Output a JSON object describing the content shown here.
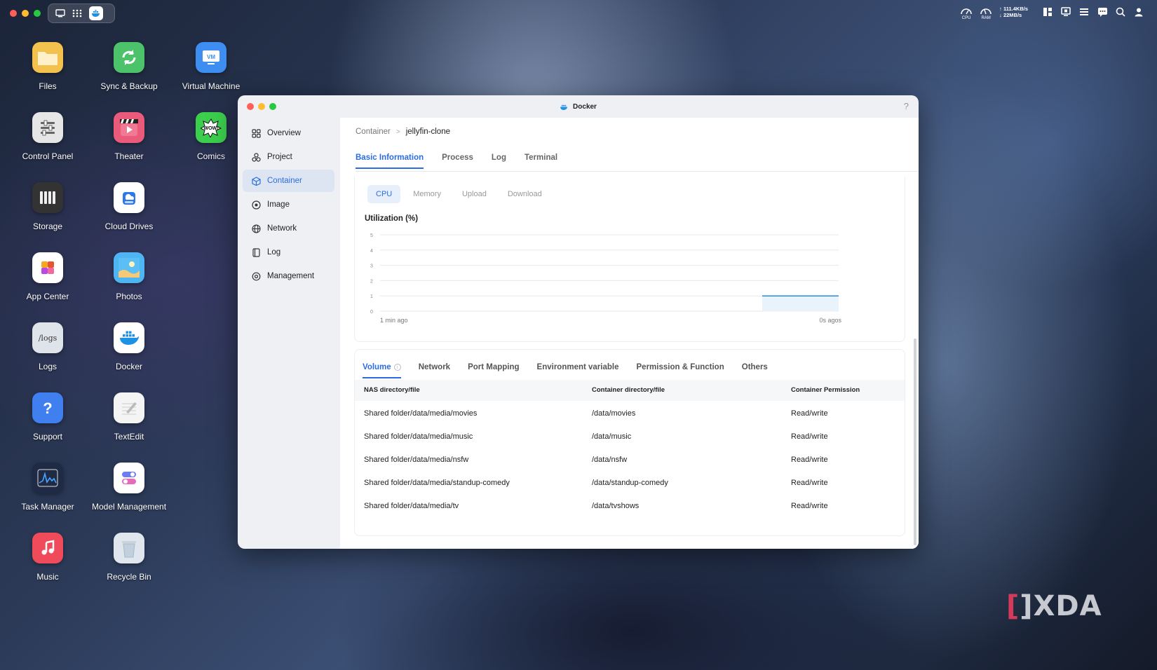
{
  "menubar": {
    "traffic_colors": [
      "#ff5f57",
      "#febc2e",
      "#28c840"
    ],
    "tray": {
      "cpu_label": "CPU",
      "ram_label": "RAM",
      "upload_speed": "↑ 111.4KB/s",
      "download_speed": "↓ 22MB/s"
    }
  },
  "desktop": {
    "icons": [
      {
        "label": "Files",
        "icon": "folder-icon",
        "color": "#f2c14e"
      },
      {
        "label": "Sync & Backup",
        "icon": "sync-icon",
        "color": "#4cc36a"
      },
      {
        "label": "Virtual Machine",
        "icon": "vm-icon",
        "color": "#3d8ef0"
      },
      {
        "label": "Control Panel",
        "icon": "sliders-icon",
        "color": "#e6e6e6"
      },
      {
        "label": "Theater",
        "icon": "clapper-icon",
        "color": "#ea5a7a"
      },
      {
        "label": "Comics",
        "icon": "wow-icon",
        "color": "#3ccf4e"
      },
      {
        "label": "Storage",
        "icon": "drives-icon",
        "color": "#333333"
      },
      {
        "label": "Cloud Drives",
        "icon": "cloud-drive-icon",
        "color": "#ffffff"
      },
      {
        "label": "App Center",
        "icon": "app-grid-icon",
        "color": "#ffffff"
      },
      {
        "label": "Photos",
        "icon": "photos-icon",
        "color": "#4fb5f2"
      },
      {
        "label": "Logs",
        "icon": "logs-icon",
        "color": "#dfe3ea",
        "text": "/logs"
      },
      {
        "label": "Docker",
        "icon": "docker-icon",
        "color": "#ffffff"
      },
      {
        "label": "Support",
        "icon": "help-icon",
        "color": "#3f7ff0"
      },
      {
        "label": "TextEdit",
        "icon": "textedit-icon",
        "color": "#f4f4f4"
      },
      {
        "label": "Task Manager",
        "icon": "activity-icon",
        "color": "#1f2a44"
      },
      {
        "label": "Model Management",
        "icon": "toggles-icon",
        "color": "#ffffff"
      },
      {
        "label": "Music",
        "icon": "music-note-icon",
        "color": "#ef4b5a"
      },
      {
        "label": "Recycle Bin",
        "icon": "trash-icon",
        "color": "#dfe6ee"
      }
    ]
  },
  "window": {
    "title": "Docker",
    "help": "?",
    "accent": "#2b6de0",
    "sidebar": [
      {
        "label": "Overview",
        "icon": "grid-icon",
        "active": false
      },
      {
        "label": "Project",
        "icon": "project-icon",
        "active": false
      },
      {
        "label": "Container",
        "icon": "cube-icon",
        "active": true
      },
      {
        "label": "Image",
        "icon": "disc-icon",
        "active": false
      },
      {
        "label": "Network",
        "icon": "globe-icon",
        "active": false
      },
      {
        "label": "Log",
        "icon": "log-icon",
        "active": false
      },
      {
        "label": "Management",
        "icon": "gear-icon",
        "active": false
      }
    ],
    "breadcrumb": {
      "parent": "Container",
      "separator": ">",
      "current": "jellyfin-clone"
    },
    "tabs": [
      "Basic Information",
      "Process",
      "Log",
      "Terminal"
    ],
    "active_tab": "Basic Information",
    "metric_tabs": [
      "CPU",
      "Memory",
      "Upload",
      "Download"
    ],
    "active_metric": "CPU",
    "chart_title": "Utilization (%)",
    "volume_tabs": [
      "Volume",
      "Network",
      "Port Mapping",
      "Environment variable",
      "Permission & Function",
      "Others"
    ],
    "active_volume_tab": "Volume",
    "table": {
      "headers": [
        "NAS directory/file",
        "Container directory/file",
        "Container Permission"
      ],
      "rows": [
        [
          "Shared folder/data/media/movies",
          "/data/movies",
          "Read/write"
        ],
        [
          "Shared folder/data/media/music",
          "/data/music",
          "Read/write"
        ],
        [
          "Shared folder/data/media/nsfw",
          "/data/nsfw",
          "Read/write"
        ],
        [
          "Shared folder/data/media/standup-comedy",
          "/data/standup-comedy",
          "Read/write"
        ],
        [
          "Shared folder/data/media/tv",
          "/data/tvshows",
          "Read/write"
        ]
      ]
    }
  },
  "chart_data": {
    "type": "area",
    "title": "Utilization (%)",
    "xlabel": "",
    "ylabel": "",
    "x_tick_labels": [
      "1 min ago",
      "0s agos"
    ],
    "y_ticks": [
      0,
      1,
      2,
      3,
      4,
      5
    ],
    "ylim": [
      0,
      5
    ],
    "xlim": [
      0,
      60
    ],
    "series": [
      {
        "values": [
          {
            "x": 50,
            "y": 1
          },
          {
            "x": 60,
            "y": 1
          }
        ],
        "color": "#2b8ae0"
      }
    ],
    "grid": true
  },
  "watermark": {
    "text": "XDA"
  }
}
